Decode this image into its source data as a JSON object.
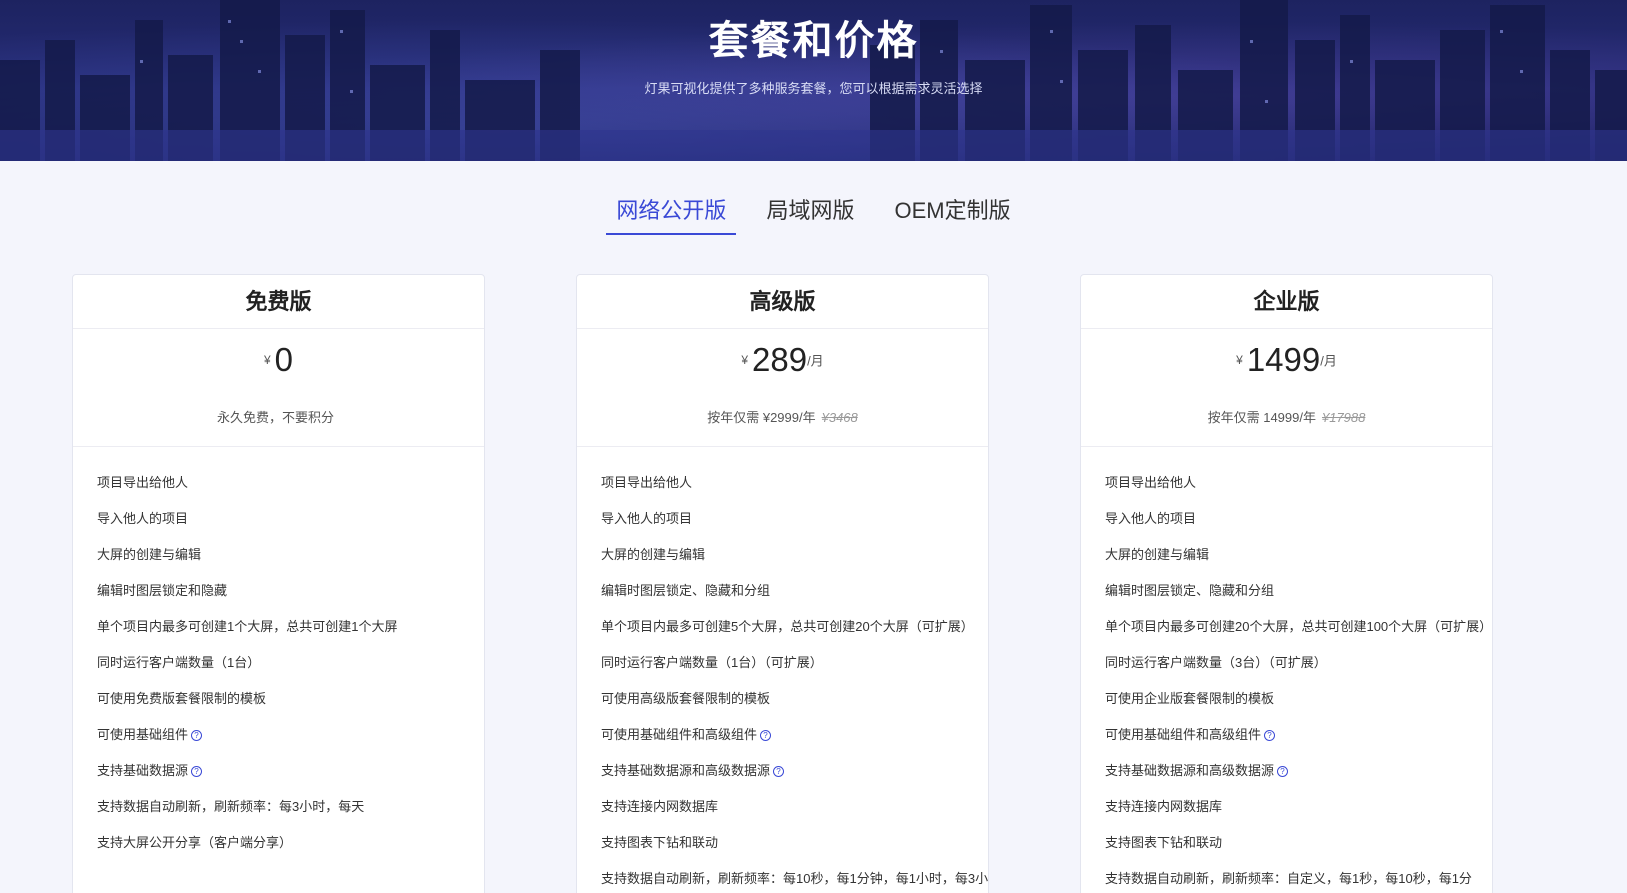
{
  "hero": {
    "title": "套餐和价格",
    "subtitle": "灯果可视化提供了多种服务套餐，您可以根据需求灵活选择"
  },
  "tabs": [
    {
      "label": "网络公开版",
      "active": true
    },
    {
      "label": "局域网版",
      "active": false
    },
    {
      "label": "OEM定制版",
      "active": false
    }
  ],
  "currency_symbol": "¥",
  "plans": [
    {
      "name": "免费版",
      "price": "0",
      "unit": "",
      "note": "永久免费，不要积分",
      "note_strike": "",
      "features": [
        {
          "text": "项目导出给他人",
          "help": false
        },
        {
          "text": "导入他人的项目",
          "help": false
        },
        {
          "text": "大屏的创建与编辑",
          "help": false
        },
        {
          "text": "编辑时图层锁定和隐藏",
          "help": false
        },
        {
          "text": "单个项目内最多可创建1个大屏，总共可创建1个大屏",
          "help": false
        },
        {
          "text": "同时运行客户端数量（1台）",
          "help": false
        },
        {
          "text": "可使用免费版套餐限制的模板",
          "help": false
        },
        {
          "text": "可使用基础组件",
          "help": true
        },
        {
          "text": "支持基础数据源",
          "help": true
        },
        {
          "text": "支持数据自动刷新，刷新频率：每3小时，每天",
          "help": false
        },
        {
          "text": "支持大屏公开分享（客户端分享）",
          "help": false
        }
      ]
    },
    {
      "name": "高级版",
      "price": "289",
      "unit": "/月",
      "note": "按年仅需 ¥2999/年",
      "note_strike": "¥3468",
      "features": [
        {
          "text": "项目导出给他人",
          "help": false
        },
        {
          "text": "导入他人的项目",
          "help": false
        },
        {
          "text": "大屏的创建与编辑",
          "help": false
        },
        {
          "text": "编辑时图层锁定、隐藏和分组",
          "help": false
        },
        {
          "text": "单个项目内最多可创建5个大屏，总共可创建20个大屏（可扩展）",
          "help": false
        },
        {
          "text": "同时运行客户端数量（1台）（可扩展）",
          "help": false
        },
        {
          "text": "可使用高级版套餐限制的模板",
          "help": false
        },
        {
          "text": "可使用基础组件和高级组件",
          "help": true
        },
        {
          "text": "支持基础数据源和高级数据源",
          "help": true
        },
        {
          "text": "支持连接内网数据库",
          "help": false
        },
        {
          "text": "支持图表下钻和联动",
          "help": false
        },
        {
          "text": "支持数据自动刷新，刷新频率：每10秒，每1分钟，每1小时，每3小",
          "help": false
        }
      ]
    },
    {
      "name": "企业版",
      "price": "1499",
      "unit": "/月",
      "note": "按年仅需 14999/年",
      "note_strike": "¥17988",
      "features": [
        {
          "text": "项目导出给他人",
          "help": false
        },
        {
          "text": "导入他人的项目",
          "help": false
        },
        {
          "text": "大屏的创建与编辑",
          "help": false
        },
        {
          "text": "编辑时图层锁定、隐藏和分组",
          "help": false
        },
        {
          "text": "单个项目内最多可创建20个大屏，总共可创建100个大屏（可扩展）",
          "help": false
        },
        {
          "text": "同时运行客户端数量（3台）（可扩展）",
          "help": false
        },
        {
          "text": "可使用企业版套餐限制的模板",
          "help": false
        },
        {
          "text": "可使用基础组件和高级组件",
          "help": true
        },
        {
          "text": "支持基础数据源和高级数据源",
          "help": true
        },
        {
          "text": "支持连接内网数据库",
          "help": false
        },
        {
          "text": "支持图表下钻和联动",
          "help": false
        },
        {
          "text": "支持数据自动刷新，刷新频率：自定义，每1秒，每10秒，每1分",
          "help": false
        }
      ]
    }
  ],
  "colors": {
    "accent": "#3a49d6",
    "hero_bg": "#232a70",
    "page_bg": "#f4f5fc"
  },
  "icons": {
    "feature_help": "question-circle-icon"
  }
}
